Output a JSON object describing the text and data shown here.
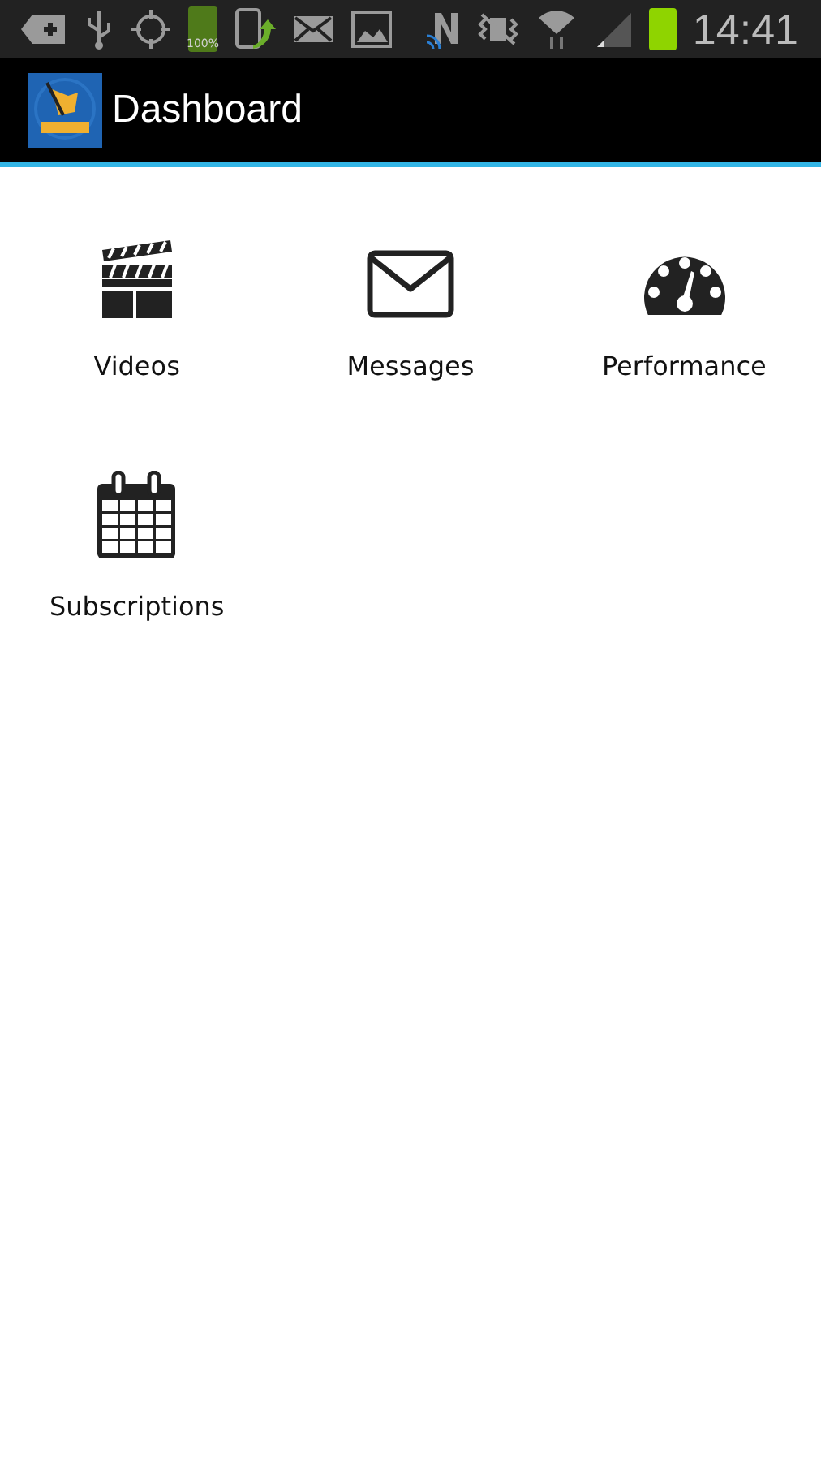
{
  "status_bar": {
    "battery_left_label": "100%",
    "time": "14:41"
  },
  "action_bar": {
    "title": "Dashboard"
  },
  "tiles": [
    {
      "kind": "videos",
      "label": "Videos"
    },
    {
      "kind": "messages",
      "label": "Messages"
    },
    {
      "kind": "performance",
      "label": "Performance"
    },
    {
      "kind": "subscriptions",
      "label": "Subscriptions"
    }
  ]
}
